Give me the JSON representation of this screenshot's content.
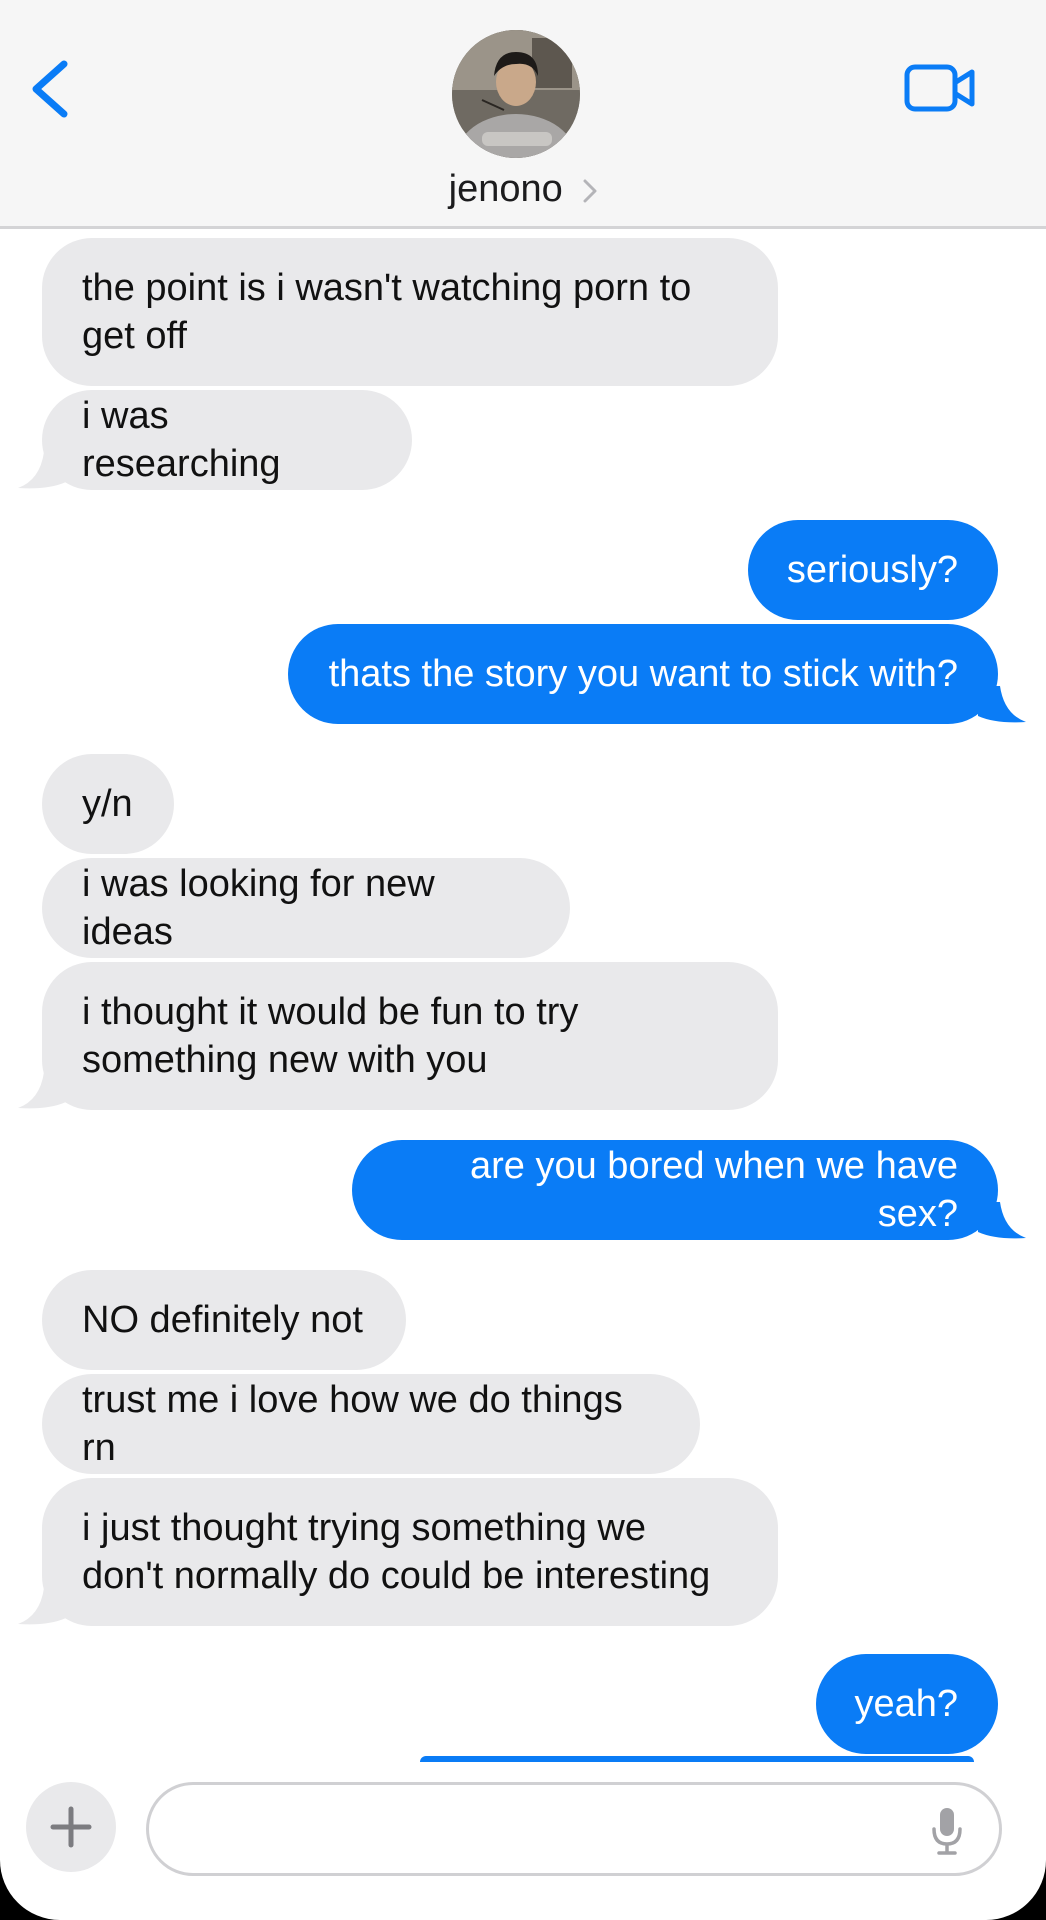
{
  "header": {
    "contact_name": "jenono",
    "back_icon": "chevron-left-icon",
    "video_icon": "video-camera-icon",
    "disclosure_icon": "chevron-right-icon"
  },
  "colors": {
    "accent": "#0a7cf6",
    "incoming_bubble": "#e9e9eb",
    "header_bg": "#f6f6f6"
  },
  "messages": [
    {
      "direction": "incoming",
      "text_lines": [
        "the point is i wasn't watching porn to",
        "get off"
      ]
    },
    {
      "direction": "incoming",
      "text_lines": [
        "i was researching"
      ]
    },
    {
      "direction": "outgoing",
      "text_lines": [
        "seriously?"
      ]
    },
    {
      "direction": "outgoing",
      "text_lines": [
        "thats the story you want to stick with?"
      ]
    },
    {
      "direction": "incoming",
      "text_lines": [
        "y/n"
      ]
    },
    {
      "direction": "incoming",
      "text_lines": [
        "i was looking for new ideas"
      ]
    },
    {
      "direction": "incoming",
      "text_lines": [
        "i thought it would be fun to try",
        "something new with you"
      ]
    },
    {
      "direction": "outgoing",
      "text_lines": [
        "are you bored when we have sex?"
      ]
    },
    {
      "direction": "incoming",
      "text_lines": [
        "NO definitely not"
      ]
    },
    {
      "direction": "incoming",
      "text_lines": [
        "trust me i love how we do things rn"
      ]
    },
    {
      "direction": "incoming",
      "text_lines": [
        "i just thought trying something we",
        "don't normally do could be interesting"
      ]
    },
    {
      "direction": "outgoing",
      "text_lines": [
        "yeah?"
      ]
    }
  ],
  "composer": {
    "value": "",
    "plus_icon": "plus-icon",
    "mic_icon": "microphone-icon"
  }
}
